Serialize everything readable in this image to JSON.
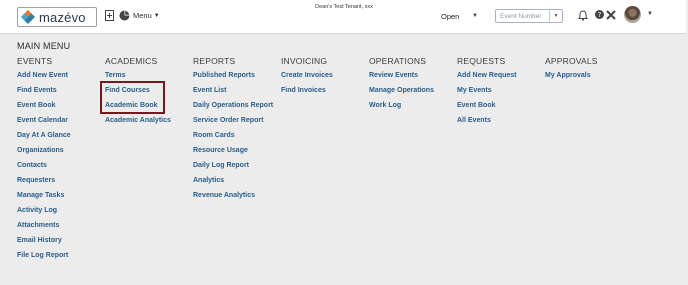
{
  "header": {
    "logo_text": "mazévo",
    "tenant": "Dean's Test Tenant, xxx",
    "menu_label": "Menu",
    "status_select": "Open",
    "event_number_placeholder": "Event Number"
  },
  "main_title": "MAIN MENU",
  "columns": [
    {
      "title": "EVENTS",
      "items": [
        "Add New Event",
        "Find Events",
        "Event Book",
        "Event Calendar",
        "Day At A Glance",
        "Organizations",
        "Contacts",
        "Requesters",
        "Manage Tasks",
        "Activity Log",
        "Attachments",
        "Email History",
        "File Log Report"
      ]
    },
    {
      "title": "ACADEMICS",
      "items": [
        "Terms",
        "Find Courses",
        "Academic Book",
        "Academic Analytics"
      ]
    },
    {
      "title": "REPORTS",
      "items": [
        "Published Reports",
        "Event List",
        "Daily Operations Report",
        "Service Order Report",
        "Room Cards",
        "Resource Usage",
        "Daily Log Report",
        "Analytics",
        "Revenue Analytics"
      ]
    },
    {
      "title": "INVOICING",
      "items": [
        "Create Invoices",
        "Find Invoices"
      ]
    },
    {
      "title": "OPERATIONS",
      "items": [
        "Review Events",
        "Manage Operations",
        "Work Log"
      ]
    },
    {
      "title": "REQUESTS",
      "items": [
        "Add New Request",
        "My Events",
        "Event Book",
        "All Events"
      ]
    },
    {
      "title": "APPROVALS",
      "items": [
        "My Approvals"
      ]
    }
  ]
}
